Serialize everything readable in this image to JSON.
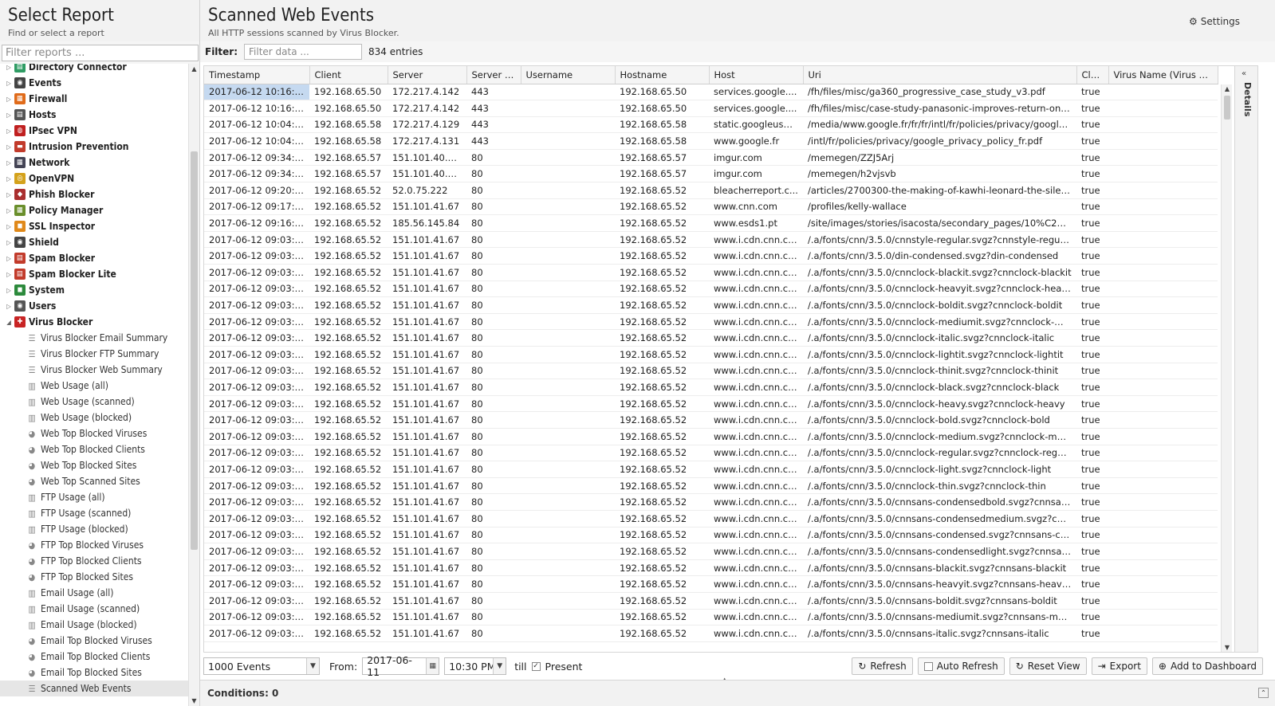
{
  "left": {
    "title": "Select Report",
    "subtitle": "Find or select a report",
    "filter_placeholder": "Filter reports ...",
    "categories": [
      {
        "label": "Directory Connector",
        "color": "#2f9c64",
        "glyph": "▤"
      },
      {
        "label": "Events",
        "color": "#444",
        "glyph": "◉"
      },
      {
        "label": "Firewall",
        "color": "#e06b1a",
        "glyph": "▦"
      },
      {
        "label": "Hosts",
        "color": "#555",
        "glyph": "▤"
      },
      {
        "label": "IPsec VPN",
        "color": "#c02020",
        "glyph": "◍"
      },
      {
        "label": "Intrusion Prevention",
        "color": "#c23b2b",
        "glyph": "▬"
      },
      {
        "label": "Network",
        "color": "#445",
        "glyph": "▦"
      },
      {
        "label": "OpenVPN",
        "color": "#d4a21c",
        "glyph": "◎"
      },
      {
        "label": "Phish Blocker",
        "color": "#aa2f2f",
        "glyph": "◆"
      },
      {
        "label": "Policy Manager",
        "color": "#6a8f2c",
        "glyph": "▦"
      },
      {
        "label": "SSL Inspector",
        "color": "#e0891a",
        "glyph": "◼"
      },
      {
        "label": "Shield",
        "color": "#444",
        "glyph": "◉"
      },
      {
        "label": "Spam Blocker",
        "color": "#c23b2b",
        "glyph": "▤"
      },
      {
        "label": "Spam Blocker Lite",
        "color": "#c23b2b",
        "glyph": "▤"
      },
      {
        "label": "System",
        "color": "#2c8a3c",
        "glyph": "◼"
      },
      {
        "label": "Users",
        "color": "#555",
        "glyph": "◉"
      },
      {
        "label": "Virus Blocker",
        "color": "#c82424",
        "glyph": "✚"
      }
    ],
    "children": [
      {
        "label": "Virus Blocker Email Summary",
        "icon": "☰"
      },
      {
        "label": "Virus Blocker FTP Summary",
        "icon": "☰"
      },
      {
        "label": "Virus Blocker Web Summary",
        "icon": "☰"
      },
      {
        "label": "Web Usage (all)",
        "icon": "▥"
      },
      {
        "label": "Web Usage (scanned)",
        "icon": "▥"
      },
      {
        "label": "Web Usage (blocked)",
        "icon": "▥"
      },
      {
        "label": "Web Top Blocked Viruses",
        "icon": "◕"
      },
      {
        "label": "Web Top Blocked Clients",
        "icon": "◕"
      },
      {
        "label": "Web Top Blocked Sites",
        "icon": "◕"
      },
      {
        "label": "Web Top Scanned Sites",
        "icon": "◕"
      },
      {
        "label": "FTP Usage (all)",
        "icon": "▥"
      },
      {
        "label": "FTP Usage (scanned)",
        "icon": "▥"
      },
      {
        "label": "FTP Usage (blocked)",
        "icon": "▥"
      },
      {
        "label": "FTP Top Blocked Viruses",
        "icon": "◕"
      },
      {
        "label": "FTP Top Blocked Clients",
        "icon": "◕"
      },
      {
        "label": "FTP Top Blocked Sites",
        "icon": "◕"
      },
      {
        "label": "Email Usage (all)",
        "icon": "▥"
      },
      {
        "label": "Email Usage (scanned)",
        "icon": "▥"
      },
      {
        "label": "Email Usage (blocked)",
        "icon": "▥"
      },
      {
        "label": "Email Top Blocked Viruses",
        "icon": "◕"
      },
      {
        "label": "Email Top Blocked Clients",
        "icon": "◕"
      },
      {
        "label": "Email Top Blocked Sites",
        "icon": "◕"
      },
      {
        "label": "Scanned Web Events",
        "icon": "☰"
      }
    ]
  },
  "main": {
    "title": "Scanned Web Events",
    "subtitle": "All HTTP sessions scanned by Virus Blocker.",
    "settings_label": "Settings",
    "filter_label": "Filter:",
    "filter_placeholder": "Filter data ...",
    "entries": "834 entries",
    "details_label": "Details"
  },
  "grid": {
    "columns": [
      "Timestamp",
      "Client",
      "Server",
      "Server P...",
      "Username",
      "Hostname",
      "Host",
      "Uri",
      "Cle...",
      "Virus Name (Virus B..."
    ],
    "rows": [
      [
        "2017-06-12 10:16:3...",
        "192.168.65.50",
        "172.217.4.142",
        "443",
        "",
        "192.168.65.50",
        "services.google....",
        "/fh/files/misc/ga360_progressive_case_study_v3.pdf",
        "true",
        ""
      ],
      [
        "2017-06-12 10:16:3...",
        "192.168.65.50",
        "172.217.4.142",
        "443",
        "",
        "192.168.65.50",
        "services.google....",
        "/fh/files/misc/case-study-panasonic-improves-return-on-a...",
        "true",
        ""
      ],
      [
        "2017-06-12 10:04:2...",
        "192.168.65.58",
        "172.217.4.129",
        "443",
        "",
        "192.168.65.58",
        "static.googleuser...",
        "/media/www.google.fr/fr/fr/intl/fr/policies/privacy/google_p...",
        "true",
        ""
      ],
      [
        "2017-06-12 10:04:2...",
        "192.168.65.58",
        "172.217.4.131",
        "443",
        "",
        "192.168.65.58",
        "www.google.fr",
        "/intl/fr/policies/privacy/google_privacy_policy_fr.pdf",
        "true",
        ""
      ],
      [
        "2017-06-12 09:34:2...",
        "192.168.65.57",
        "151.101.40.1...",
        "80",
        "",
        "192.168.65.57",
        "imgur.com",
        "/memegen/ZZJ5Arj",
        "true",
        ""
      ],
      [
        "2017-06-12 09:34:2...",
        "192.168.65.57",
        "151.101.40.1...",
        "80",
        "",
        "192.168.65.57",
        "imgur.com",
        "/memegen/h2vjsvb",
        "true",
        ""
      ],
      [
        "2017-06-12 09:20:1...",
        "192.168.65.52",
        "52.0.75.222",
        "80",
        "",
        "192.168.65.52",
        "bleacherreport.c...",
        "/articles/2700300-the-making-of-kawhi-leonard-the-silent-...",
        "true",
        ""
      ],
      [
        "2017-06-12 09:17:5...",
        "192.168.65.52",
        "151.101.41.67",
        "80",
        "",
        "192.168.65.52",
        "www.cnn.com",
        "/profiles/kelly-wallace",
        "true",
        ""
      ],
      [
        "2017-06-12 09:16:4...",
        "192.168.65.52",
        "185.56.145.84",
        "80",
        "",
        "192.168.65.52",
        "www.esds1.pt",
        "/site/images/stories/isacosta/secondary_pages/10%C2%...",
        "true",
        ""
      ],
      [
        "2017-06-12 09:03:0...",
        "192.168.65.52",
        "151.101.41.67",
        "80",
        "",
        "192.168.65.52",
        "www.i.cdn.cnn.co...",
        "/.a/fonts/cnn/3.5.0/cnnstyle-regular.svgz?cnnstyle-regular",
        "true",
        ""
      ],
      [
        "2017-06-12 09:03:0...",
        "192.168.65.52",
        "151.101.41.67",
        "80",
        "",
        "192.168.65.52",
        "www.i.cdn.cnn.co...",
        "/.a/fonts/cnn/3.5.0/din-condensed.svgz?din-condensed",
        "true",
        ""
      ],
      [
        "2017-06-12 09:03:0...",
        "192.168.65.52",
        "151.101.41.67",
        "80",
        "",
        "192.168.65.52",
        "www.i.cdn.cnn.co...",
        "/.a/fonts/cnn/3.5.0/cnnclock-blackit.svgz?cnnclock-blackit",
        "true",
        ""
      ],
      [
        "2017-06-12 09:03:0...",
        "192.168.65.52",
        "151.101.41.67",
        "80",
        "",
        "192.168.65.52",
        "www.i.cdn.cnn.co...",
        "/.a/fonts/cnn/3.5.0/cnnclock-heavyit.svgz?cnnclock-heavyit",
        "true",
        ""
      ],
      [
        "2017-06-12 09:03:0...",
        "192.168.65.52",
        "151.101.41.67",
        "80",
        "",
        "192.168.65.52",
        "www.i.cdn.cnn.co...",
        "/.a/fonts/cnn/3.5.0/cnnclock-boldit.svgz?cnnclock-boldit",
        "true",
        ""
      ],
      [
        "2017-06-12 09:03:0...",
        "192.168.65.52",
        "151.101.41.67",
        "80",
        "",
        "192.168.65.52",
        "www.i.cdn.cnn.co...",
        "/.a/fonts/cnn/3.5.0/cnnclock-mediumit.svgz?cnnclock-med...",
        "true",
        ""
      ],
      [
        "2017-06-12 09:03:0...",
        "192.168.65.52",
        "151.101.41.67",
        "80",
        "",
        "192.168.65.52",
        "www.i.cdn.cnn.co...",
        "/.a/fonts/cnn/3.5.0/cnnclock-italic.svgz?cnnclock-italic",
        "true",
        ""
      ],
      [
        "2017-06-12 09:03:0...",
        "192.168.65.52",
        "151.101.41.67",
        "80",
        "",
        "192.168.65.52",
        "www.i.cdn.cnn.co...",
        "/.a/fonts/cnn/3.5.0/cnnclock-lightit.svgz?cnnclock-lightit",
        "true",
        ""
      ],
      [
        "2017-06-12 09:03:0...",
        "192.168.65.52",
        "151.101.41.67",
        "80",
        "",
        "192.168.65.52",
        "www.i.cdn.cnn.co...",
        "/.a/fonts/cnn/3.5.0/cnnclock-thinit.svgz?cnnclock-thinit",
        "true",
        ""
      ],
      [
        "2017-06-12 09:03:0...",
        "192.168.65.52",
        "151.101.41.67",
        "80",
        "",
        "192.168.65.52",
        "www.i.cdn.cnn.co...",
        "/.a/fonts/cnn/3.5.0/cnnclock-black.svgz?cnnclock-black",
        "true",
        ""
      ],
      [
        "2017-06-12 09:03:0...",
        "192.168.65.52",
        "151.101.41.67",
        "80",
        "",
        "192.168.65.52",
        "www.i.cdn.cnn.co...",
        "/.a/fonts/cnn/3.5.0/cnnclock-heavy.svgz?cnnclock-heavy",
        "true",
        ""
      ],
      [
        "2017-06-12 09:03:0...",
        "192.168.65.52",
        "151.101.41.67",
        "80",
        "",
        "192.168.65.52",
        "www.i.cdn.cnn.co...",
        "/.a/fonts/cnn/3.5.0/cnnclock-bold.svgz?cnnclock-bold",
        "true",
        ""
      ],
      [
        "2017-06-12 09:03:0...",
        "192.168.65.52",
        "151.101.41.67",
        "80",
        "",
        "192.168.65.52",
        "www.i.cdn.cnn.co...",
        "/.a/fonts/cnn/3.5.0/cnnclock-medium.svgz?cnnclock-mediu...",
        "true",
        ""
      ],
      [
        "2017-06-12 09:03:0...",
        "192.168.65.52",
        "151.101.41.67",
        "80",
        "",
        "192.168.65.52",
        "www.i.cdn.cnn.co...",
        "/.a/fonts/cnn/3.5.0/cnnclock-regular.svgz?cnnclock-regular",
        "true",
        ""
      ],
      [
        "2017-06-12 09:03:0...",
        "192.168.65.52",
        "151.101.41.67",
        "80",
        "",
        "192.168.65.52",
        "www.i.cdn.cnn.co...",
        "/.a/fonts/cnn/3.5.0/cnnclock-light.svgz?cnnclock-light",
        "true",
        ""
      ],
      [
        "2017-06-12 09:03:0...",
        "192.168.65.52",
        "151.101.41.67",
        "80",
        "",
        "192.168.65.52",
        "www.i.cdn.cnn.co...",
        "/.a/fonts/cnn/3.5.0/cnnclock-thin.svgz?cnnclock-thin",
        "true",
        ""
      ],
      [
        "2017-06-12 09:03:0...",
        "192.168.65.52",
        "151.101.41.67",
        "80",
        "",
        "192.168.65.52",
        "www.i.cdn.cnn.co...",
        "/.a/fonts/cnn/3.5.0/cnnsans-condensedbold.svgz?cnnsans...",
        "true",
        ""
      ],
      [
        "2017-06-12 09:03:0...",
        "192.168.65.52",
        "151.101.41.67",
        "80",
        "",
        "192.168.65.52",
        "www.i.cdn.cnn.co...",
        "/.a/fonts/cnn/3.5.0/cnnsans-condensedmedium.svgz?cnn...",
        "true",
        ""
      ],
      [
        "2017-06-12 09:03:0...",
        "192.168.65.52",
        "151.101.41.67",
        "80",
        "",
        "192.168.65.52",
        "www.i.cdn.cnn.co...",
        "/.a/fonts/cnn/3.5.0/cnnsans-condensed.svgz?cnnsans-con...",
        "true",
        ""
      ],
      [
        "2017-06-12 09:03:0...",
        "192.168.65.52",
        "151.101.41.67",
        "80",
        "",
        "192.168.65.52",
        "www.i.cdn.cnn.co...",
        "/.a/fonts/cnn/3.5.0/cnnsans-condensedlight.svgz?cnnsans...",
        "true",
        ""
      ],
      [
        "2017-06-12 09:03:0...",
        "192.168.65.52",
        "151.101.41.67",
        "80",
        "",
        "192.168.65.52",
        "www.i.cdn.cnn.co...",
        "/.a/fonts/cnn/3.5.0/cnnsans-blackit.svgz?cnnsans-blackit",
        "true",
        ""
      ],
      [
        "2017-06-12 09:03:0...",
        "192.168.65.52",
        "151.101.41.67",
        "80",
        "",
        "192.168.65.52",
        "www.i.cdn.cnn.co...",
        "/.a/fonts/cnn/3.5.0/cnnsans-heavyit.svgz?cnnsans-heavyit",
        "true",
        ""
      ],
      [
        "2017-06-12 09:03:0...",
        "192.168.65.52",
        "151.101.41.67",
        "80",
        "",
        "192.168.65.52",
        "www.i.cdn.cnn.co...",
        "/.a/fonts/cnn/3.5.0/cnnsans-boldit.svgz?cnnsans-boldit",
        "true",
        ""
      ],
      [
        "2017-06-12 09:03:0...",
        "192.168.65.52",
        "151.101.41.67",
        "80",
        "",
        "192.168.65.52",
        "www.i.cdn.cnn.co...",
        "/.a/fonts/cnn/3.5.0/cnnsans-mediumit.svgz?cnnsans-med...",
        "true",
        ""
      ],
      [
        "2017-06-12 09:03:0...",
        "192.168.65.52",
        "151.101.41.67",
        "80",
        "",
        "192.168.65.52",
        "www.i.cdn.cnn.co...",
        "/.a/fonts/cnn/3.5.0/cnnsans-italic.svgz?cnnsans-italic",
        "true",
        ""
      ]
    ]
  },
  "toolbar": {
    "limit": "1000 Events",
    "from_label": "From:",
    "from_date": "2017-06-11",
    "from_time": "10:30 PM",
    "till_label": "till",
    "present_label": "Present",
    "present_checked": true,
    "refresh": "Refresh",
    "auto_refresh": "Auto Refresh",
    "reset_view": "Reset View",
    "export": "Export",
    "add_dashboard": "Add to Dashboard"
  },
  "conditions": "Conditions: 0"
}
